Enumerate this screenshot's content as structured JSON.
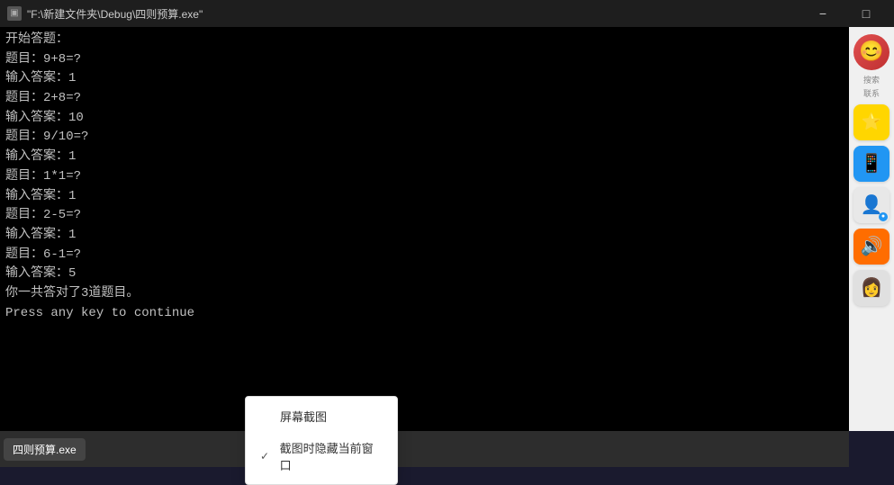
{
  "titlebar": {
    "title": "\"F:\\新建文件夹\\Debug\\四则预算.exe\"",
    "minimize_label": "−",
    "maximize_label": "□",
    "icon": "▣"
  },
  "terminal": {
    "lines": [
      "开始答题：",
      "",
      "题目：9+8=?",
      "输入答案：1",
      "",
      "题目：2+8=?",
      "输入答案：10",
      "",
      "题目：9/10=?",
      "输入答案：1",
      "",
      "题目：1*1=?",
      "输入答案：1",
      "",
      "题目：2-5=?",
      "输入答案：1",
      "",
      "题目：6-1=?",
      "输入答案：5",
      "你一共答对了3道题目。",
      "Press any key to continue"
    ]
  },
  "sidebar": {
    "avatar_alt": "user avatar",
    "search_label": "搜索",
    "contacts_label": "联系",
    "icons": [
      {
        "name": "star-icon",
        "symbol": "⭐",
        "bg": "yellow-bg"
      },
      {
        "name": "phone-icon",
        "symbol": "📱",
        "bg": "blue-bg"
      },
      {
        "name": "person-icon",
        "symbol": "👤",
        "bg": ""
      },
      {
        "name": "sound-icon",
        "symbol": "🔊",
        "bg": "orange-sound"
      },
      {
        "name": "avatar2-icon",
        "symbol": "👩",
        "bg": ""
      }
    ]
  },
  "context_menu": {
    "items": [
      {
        "label": "屏幕截图",
        "checked": false
      },
      {
        "label": "截图时隐藏当前窗口",
        "checked": true
      }
    ]
  },
  "taskbar": {
    "item_label": "四则预算.exe"
  }
}
